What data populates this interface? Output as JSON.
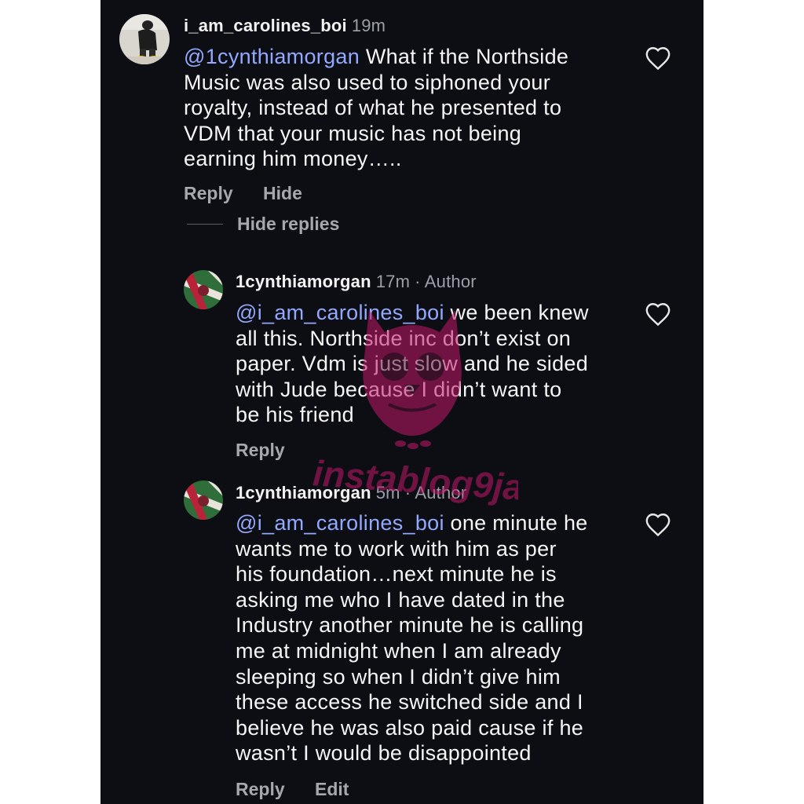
{
  "comments": [
    {
      "username": "i_am_carolines_boi",
      "time": "19m",
      "lines": [
        [
          {
            "t": "@1cynthiamorgan",
            "mention": true
          },
          {
            "t": " What if the Northside"
          }
        ],
        [
          {
            "t": "Music was also used to siphoned your"
          }
        ],
        [
          {
            "t": "royalty, instead of what he presented to"
          }
        ],
        [
          {
            "t": "VDM that your music has not being"
          }
        ],
        [
          {
            "t": "earning him money….."
          }
        ]
      ],
      "actions": [
        "Reply",
        "Hide"
      ]
    },
    {
      "username": "1cynthiamorgan",
      "time": "17m",
      "role": "· Author",
      "lines": [
        [
          {
            "t": "@i_am_carolines_boi",
            "mention": true
          },
          {
            "t": " we been knew"
          }
        ],
        [
          {
            "t": "all this. Northside inc don’t exist on"
          }
        ],
        [
          {
            "t": "paper. Vdm is just slow and he sided"
          }
        ],
        [
          {
            "t": "with Jude because I didn’t want to"
          }
        ],
        [
          {
            "t": "be his friend"
          }
        ]
      ],
      "actions": [
        "Reply"
      ]
    },
    {
      "username": "1cynthiamorgan",
      "time": "5m",
      "role": "· Author",
      "lines": [
        [
          {
            "t": "@i_am_carolines_boi",
            "mention": true
          },
          {
            "t": " one minute he"
          }
        ],
        [
          {
            "t": "wants me to work with him as per"
          }
        ],
        [
          {
            "t": "his foundation…next minute he is"
          }
        ],
        [
          {
            "t": "asking me who I have dated in the"
          }
        ],
        [
          {
            "t": "Industry another minute he is calling"
          }
        ],
        [
          {
            "t": "me at midnight when I am already"
          }
        ],
        [
          {
            "t": "sleeping so when I didn’t give him"
          }
        ],
        [
          {
            "t": "these access he switched side and I"
          }
        ],
        [
          {
            "t": "believe he was also paid cause if he"
          }
        ],
        [
          {
            "t": "wasn’t I would be disappointed"
          }
        ]
      ],
      "actions": [
        "Reply",
        "Edit"
      ]
    }
  ],
  "thread": {
    "hide_replies": "Hide replies"
  },
  "watermark": {
    "text": "instablog9ja"
  },
  "colors": {
    "background": "#0c0e13",
    "mention": "#93a8ff",
    "text": "#f5f5f5",
    "muted": "#a6a8ac",
    "watermark": "#c2186b"
  },
  "icons": {
    "like": "heart-outline-icon",
    "avatar_author": "avatar-icon"
  }
}
